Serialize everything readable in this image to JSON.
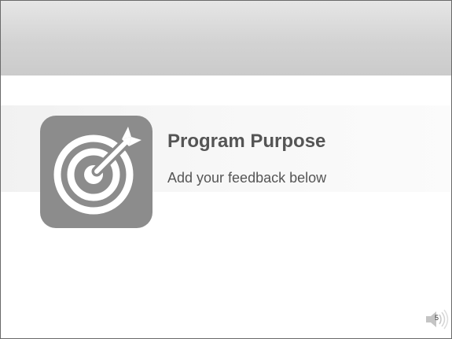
{
  "slide": {
    "title": "Program Purpose",
    "subtitle": "Add your feedback below",
    "page_number": "5"
  },
  "icons": {
    "main": "target-arrow-icon",
    "audio": "speaker-icon"
  },
  "colors": {
    "tile": "#8c8c8c",
    "text": "#555555",
    "header": "#d3d3d3"
  }
}
